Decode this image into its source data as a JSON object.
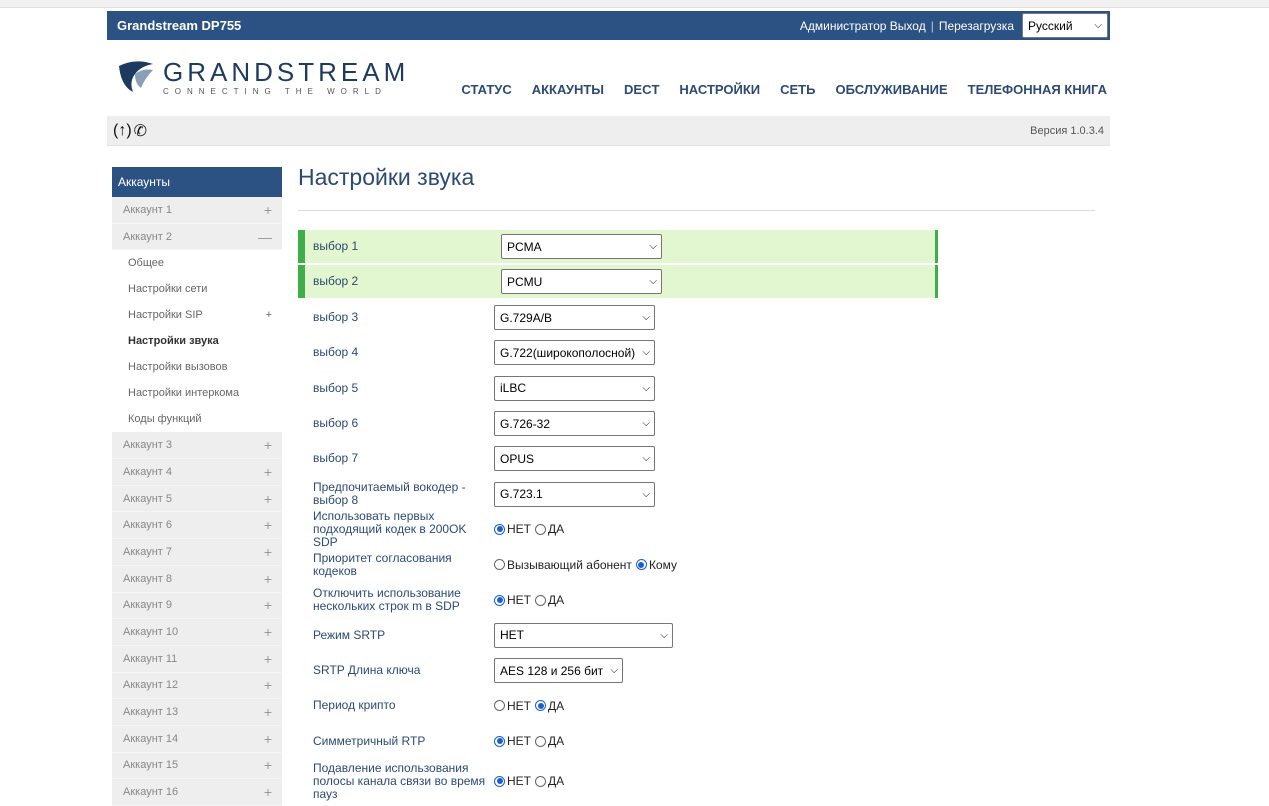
{
  "header": {
    "model": "Grandstream DP755",
    "admin": "Администратор",
    "logout": "Выход",
    "reboot": "Перезагрузка",
    "language": "Русский",
    "logo_name": "GRANDSTREAM",
    "logo_tag": "CONNECTING THE WORLD"
  },
  "nav": [
    "СТАТУС",
    "АККАУНТЫ",
    "DECT",
    "НАСТРОЙКИ",
    "СЕТЬ",
    "ОБСЛУЖИВАНИЕ",
    "ТЕЛЕФОННАЯ КНИГА"
  ],
  "status": {
    "version": "Версия 1.0.3.4"
  },
  "sidebar": {
    "head": "Аккаунты",
    "account1": "Аккаунт 1",
    "account2": "Аккаунт 2",
    "sub": [
      "Общее",
      "Настройки сети",
      "Настройки SIP",
      "Настройки звука",
      "Настройки вызовов",
      "Настройки интеркома",
      "Коды функций"
    ],
    "rest": [
      "Аккаунт 3",
      "Аккаунт 4",
      "Аккаунт 5",
      "Аккаунт 6",
      "Аккаунт 7",
      "Аккаунт 8",
      "Аккаунт 9",
      "Аккаунт 10",
      "Аккаунт 11",
      "Аккаунт 12",
      "Аккаунт 13",
      "Аккаунт 14",
      "Аккаунт 15",
      "Аккаунт 16"
    ]
  },
  "page": {
    "title": "Настройки звука"
  },
  "form": {
    "choice1": {
      "label": "выбор 1",
      "value": "PCMA"
    },
    "choice2": {
      "label": "выбор 2",
      "value": "PCMU"
    },
    "choice3": {
      "label": "выбор 3",
      "value": "G.729A/B"
    },
    "choice4": {
      "label": "выбор 4",
      "value": "G.722(широкополосной)"
    },
    "choice5": {
      "label": "выбор 5",
      "value": "iLBC"
    },
    "choice6": {
      "label": "выбор 6",
      "value": "G.726-32"
    },
    "choice7": {
      "label": "выбор 7",
      "value": "OPUS"
    },
    "choice8": {
      "label": "Предпочитаемый вокодер - выбор 8",
      "value": "G.723.1"
    },
    "first_codec": {
      "label": "Использовать первых подходящий кодек в 200OK SDP",
      "no": "НЕТ",
      "yes": "ДА"
    },
    "priority": {
      "label": "Приоритет согласования кодеков",
      "caller": "Вызывающий абонент",
      "callee": "Кому"
    },
    "disable_m": {
      "label": "Отключить использование нескольких строк m в SDP",
      "no": "НЕТ",
      "yes": "ДА"
    },
    "srtp_mode": {
      "label": "Режим SRTP",
      "value": "НЕТ"
    },
    "srtp_key": {
      "label": "SRTP Длина ключа",
      "value": "AES 128 и 256 бит"
    },
    "crypto": {
      "label": "Период крипто",
      "no": "НЕТ",
      "yes": "ДА"
    },
    "sym_rtp": {
      "label": "Симметричный RTP",
      "no": "НЕТ",
      "yes": "ДА"
    },
    "silence": {
      "label": "Подавление использования полосы канала связи во время пауз",
      "no": "НЕТ",
      "yes": "ДА"
    }
  }
}
